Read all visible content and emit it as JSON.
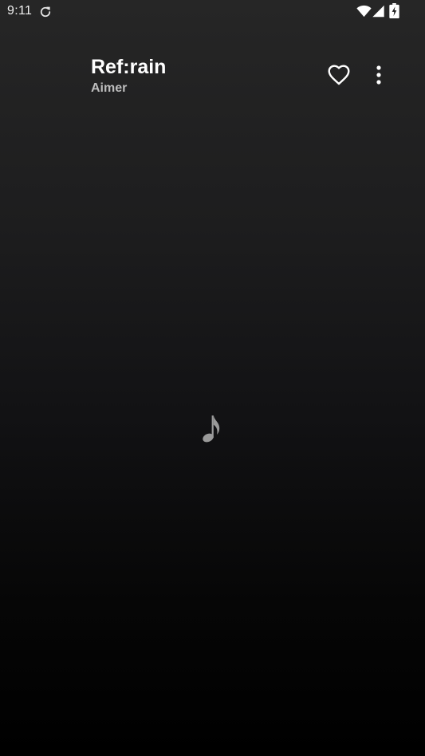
{
  "status_bar": {
    "time": "9:11",
    "icons": [
      "sync-icon",
      "wifi-icon",
      "signal-icon",
      "battery-charging-icon"
    ]
  },
  "track": {
    "title": "Ref:rain",
    "artist": "Aimer"
  },
  "actions": {
    "favorite_icon": "heart-outline-icon",
    "more_icon": "more-vertical-icon"
  },
  "artwork": {
    "placeholder_icon": "music-note-icon"
  },
  "colors": {
    "background_top": "#262626",
    "background_bottom": "#000000",
    "title": "#ffffff",
    "artist": "#bdbdbd",
    "placeholder_icon": "#9a9a9a"
  }
}
